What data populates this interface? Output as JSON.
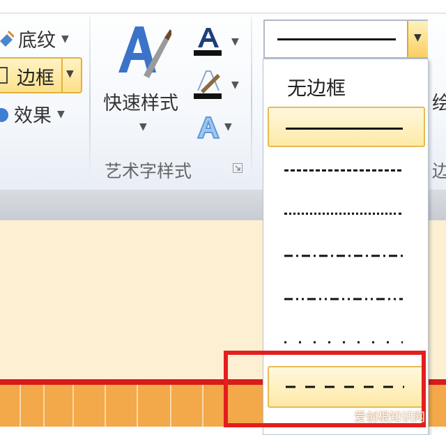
{
  "ribbon": {
    "shading_label": "底纹",
    "border_label": "边框",
    "effects_label": "效果",
    "quick_styles_label": "快速样式",
    "group_label": "艺术字样式",
    "right_cut_label_1": "绘",
    "right_cut_label_2": "边"
  },
  "dropdown": {
    "no_border_label": "无边框",
    "items": [
      "solid",
      "long-dash",
      "dotted",
      "dash-dot",
      "dash-dot-dot",
      "sparse-dot",
      "short-dash"
    ],
    "selected_index": 0
  },
  "watermark": "爱创根知识网",
  "colors": {
    "highlight_red": "#e41e1e",
    "hover_gold": "#e6bb52",
    "doc_background": "#fdf0d2"
  }
}
